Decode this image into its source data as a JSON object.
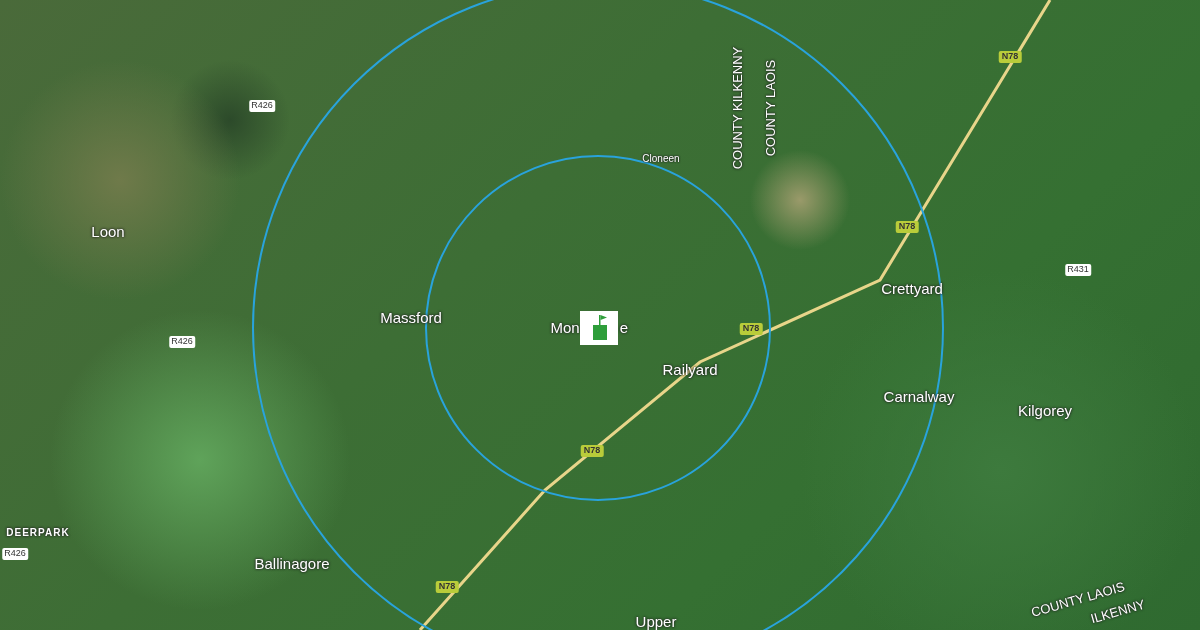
{
  "map": {
    "labels": [
      {
        "kind": "place",
        "text": "Loon"
      },
      {
        "kind": "place",
        "text": "Massford"
      },
      {
        "kind": "place",
        "text": "Mon"
      },
      {
        "kind": "place",
        "text": "e"
      },
      {
        "kind": "place",
        "text": "Railyard"
      },
      {
        "kind": "place",
        "text": "Crettyard"
      },
      {
        "kind": "place",
        "text": "Carnalway"
      },
      {
        "kind": "place",
        "text": "Kilgorey"
      },
      {
        "kind": "place",
        "text": "Ballinagore"
      },
      {
        "kind": "place",
        "text": "Upper"
      },
      {
        "kind": "locality",
        "text": "DEERPARK"
      },
      {
        "kind": "small",
        "text": "Cloneen"
      },
      {
        "kind": "county",
        "text": "COUNTY KILKENNY"
      },
      {
        "kind": "county",
        "text": "COUNTY LAOIS"
      },
      {
        "kind": "county",
        "text": "COUNTY LAOIS"
      },
      {
        "kind": "county",
        "text": "ILKENNY"
      },
      {
        "kind": "regional-road",
        "text": "R426"
      },
      {
        "kind": "regional-road",
        "text": "R426"
      },
      {
        "kind": "regional-road",
        "text": "R426"
      },
      {
        "kind": "regional-road",
        "text": "R431"
      },
      {
        "kind": "national-road",
        "text": "N78"
      },
      {
        "kind": "national-road",
        "text": "N78"
      },
      {
        "kind": "national-road",
        "text": "N78"
      },
      {
        "kind": "national-road",
        "text": "N78"
      },
      {
        "kind": "national-road",
        "text": "N78"
      }
    ]
  }
}
